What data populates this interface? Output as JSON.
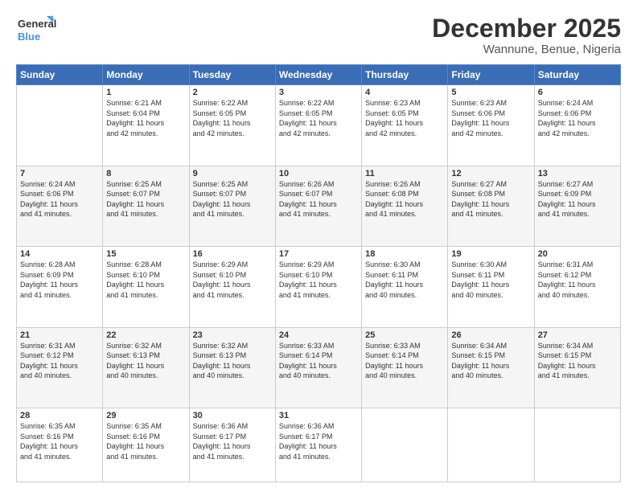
{
  "header": {
    "logo_line1": "General",
    "logo_line2": "Blue",
    "title": "December 2025",
    "subtitle": "Wannune, Benue, Nigeria"
  },
  "calendar": {
    "days_of_week": [
      "Sunday",
      "Monday",
      "Tuesday",
      "Wednesday",
      "Thursday",
      "Friday",
      "Saturday"
    ],
    "weeks": [
      [
        {
          "day": "",
          "info": ""
        },
        {
          "day": "1",
          "info": "Sunrise: 6:21 AM\nSunset: 6:04 PM\nDaylight: 11 hours\nand 42 minutes."
        },
        {
          "day": "2",
          "info": "Sunrise: 6:22 AM\nSunset: 6:05 PM\nDaylight: 11 hours\nand 42 minutes."
        },
        {
          "day": "3",
          "info": "Sunrise: 6:22 AM\nSunset: 6:05 PM\nDaylight: 11 hours\nand 42 minutes."
        },
        {
          "day": "4",
          "info": "Sunrise: 6:23 AM\nSunset: 6:05 PM\nDaylight: 11 hours\nand 42 minutes."
        },
        {
          "day": "5",
          "info": "Sunrise: 6:23 AM\nSunset: 6:06 PM\nDaylight: 11 hours\nand 42 minutes."
        },
        {
          "day": "6",
          "info": "Sunrise: 6:24 AM\nSunset: 6:06 PM\nDaylight: 11 hours\nand 42 minutes."
        }
      ],
      [
        {
          "day": "7",
          "info": "Sunrise: 6:24 AM\nSunset: 6:06 PM\nDaylight: 11 hours\nand 41 minutes."
        },
        {
          "day": "8",
          "info": "Sunrise: 6:25 AM\nSunset: 6:07 PM\nDaylight: 11 hours\nand 41 minutes."
        },
        {
          "day": "9",
          "info": "Sunrise: 6:25 AM\nSunset: 6:07 PM\nDaylight: 11 hours\nand 41 minutes."
        },
        {
          "day": "10",
          "info": "Sunrise: 6:26 AM\nSunset: 6:07 PM\nDaylight: 11 hours\nand 41 minutes."
        },
        {
          "day": "11",
          "info": "Sunrise: 6:26 AM\nSunset: 6:08 PM\nDaylight: 11 hours\nand 41 minutes."
        },
        {
          "day": "12",
          "info": "Sunrise: 6:27 AM\nSunset: 6:08 PM\nDaylight: 11 hours\nand 41 minutes."
        },
        {
          "day": "13",
          "info": "Sunrise: 6:27 AM\nSunset: 6:09 PM\nDaylight: 11 hours\nand 41 minutes."
        }
      ],
      [
        {
          "day": "14",
          "info": "Sunrise: 6:28 AM\nSunset: 6:09 PM\nDaylight: 11 hours\nand 41 minutes."
        },
        {
          "day": "15",
          "info": "Sunrise: 6:28 AM\nSunset: 6:10 PM\nDaylight: 11 hours\nand 41 minutes."
        },
        {
          "day": "16",
          "info": "Sunrise: 6:29 AM\nSunset: 6:10 PM\nDaylight: 11 hours\nand 41 minutes."
        },
        {
          "day": "17",
          "info": "Sunrise: 6:29 AM\nSunset: 6:10 PM\nDaylight: 11 hours\nand 41 minutes."
        },
        {
          "day": "18",
          "info": "Sunrise: 6:30 AM\nSunset: 6:11 PM\nDaylight: 11 hours\nand 40 minutes."
        },
        {
          "day": "19",
          "info": "Sunrise: 6:30 AM\nSunset: 6:11 PM\nDaylight: 11 hours\nand 40 minutes."
        },
        {
          "day": "20",
          "info": "Sunrise: 6:31 AM\nSunset: 6:12 PM\nDaylight: 11 hours\nand 40 minutes."
        }
      ],
      [
        {
          "day": "21",
          "info": "Sunrise: 6:31 AM\nSunset: 6:12 PM\nDaylight: 11 hours\nand 40 minutes."
        },
        {
          "day": "22",
          "info": "Sunrise: 6:32 AM\nSunset: 6:13 PM\nDaylight: 11 hours\nand 40 minutes."
        },
        {
          "day": "23",
          "info": "Sunrise: 6:32 AM\nSunset: 6:13 PM\nDaylight: 11 hours\nand 40 minutes."
        },
        {
          "day": "24",
          "info": "Sunrise: 6:33 AM\nSunset: 6:14 PM\nDaylight: 11 hours\nand 40 minutes."
        },
        {
          "day": "25",
          "info": "Sunrise: 6:33 AM\nSunset: 6:14 PM\nDaylight: 11 hours\nand 40 minutes."
        },
        {
          "day": "26",
          "info": "Sunrise: 6:34 AM\nSunset: 6:15 PM\nDaylight: 11 hours\nand 40 minutes."
        },
        {
          "day": "27",
          "info": "Sunrise: 6:34 AM\nSunset: 6:15 PM\nDaylight: 11 hours\nand 41 minutes."
        }
      ],
      [
        {
          "day": "28",
          "info": "Sunrise: 6:35 AM\nSunset: 6:16 PM\nDaylight: 11 hours\nand 41 minutes."
        },
        {
          "day": "29",
          "info": "Sunrise: 6:35 AM\nSunset: 6:16 PM\nDaylight: 11 hours\nand 41 minutes."
        },
        {
          "day": "30",
          "info": "Sunrise: 6:36 AM\nSunset: 6:17 PM\nDaylight: 11 hours\nand 41 minutes."
        },
        {
          "day": "31",
          "info": "Sunrise: 6:36 AM\nSunset: 6:17 PM\nDaylight: 11 hours\nand 41 minutes."
        },
        {
          "day": "",
          "info": ""
        },
        {
          "day": "",
          "info": ""
        },
        {
          "day": "",
          "info": ""
        }
      ]
    ]
  }
}
